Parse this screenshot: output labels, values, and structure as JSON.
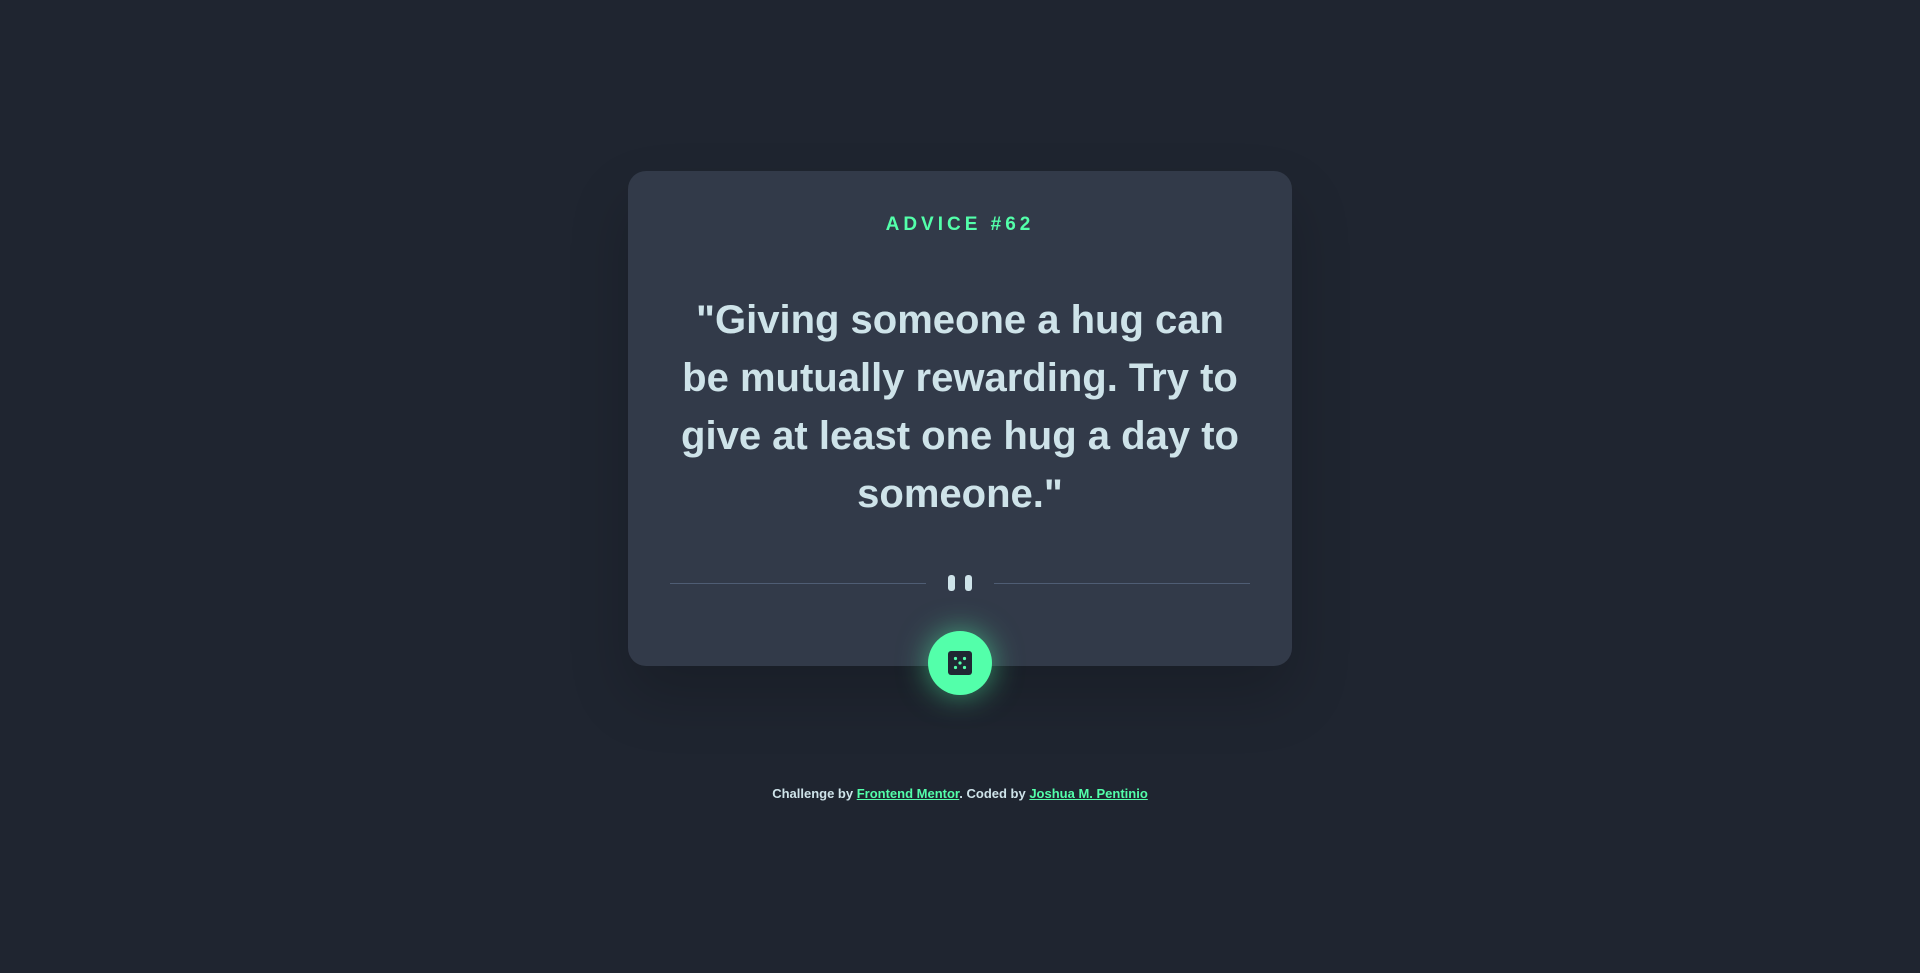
{
  "card": {
    "advice_label": "ADVICE #62",
    "quote": "\"Giving someone a hug can be mutually rewarding. Try to give at least one hug a day to someone.\""
  },
  "dice_button": {
    "icon": "dice-icon"
  },
  "divider": {
    "icon": "pause-icon"
  },
  "footer": {
    "prefix": "Challenge by ",
    "challenge_link": "Frontend Mentor",
    "middle": ". Coded by ",
    "author_link": "Joshua M. Pentinio"
  },
  "colors": {
    "background": "#1f2530",
    "card": "#323a49",
    "accent": "#53ffaa",
    "text": "#cee3e9",
    "divider": "#4f5d74"
  }
}
